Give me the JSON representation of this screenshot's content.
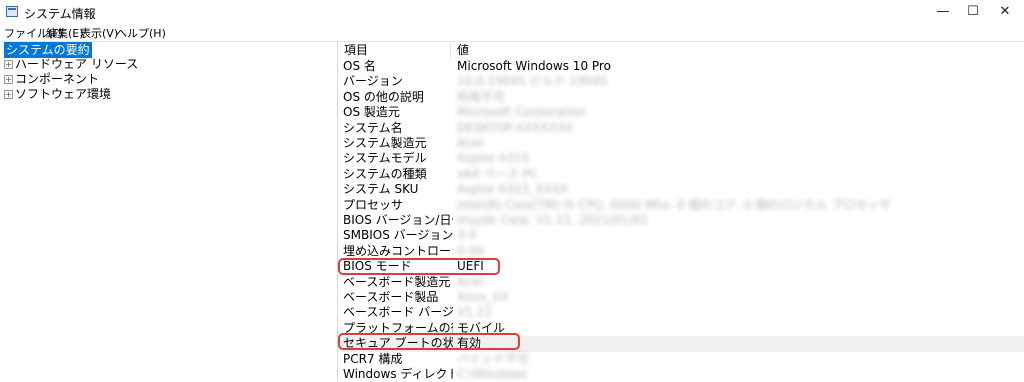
{
  "window": {
    "title": "システム情報",
    "minimize": "—",
    "maximize": "☐",
    "close": "✕"
  },
  "menu": [
    "ファイル(F)",
    "編集(E)",
    "表示(V)",
    "ヘルプ(H)"
  ],
  "tree": {
    "selected": "システムの要約",
    "items": [
      "ハードウェア リソース",
      "コンポーネント",
      "ソフトウェア環境"
    ],
    "expander": "+"
  },
  "table": {
    "headers": [
      "項目",
      "値"
    ],
    "rows": [
      {
        "item": "OS 名",
        "value": "Microsoft Windows 10 Pro",
        "redacted": false
      },
      {
        "item": "バージョン",
        "value": "10.0.19045 ビルド 19045",
        "redacted": true
      },
      {
        "item": "OS の他の説明",
        "value": "利用不可",
        "redacted": true
      },
      {
        "item": "OS 製造元",
        "value": "Microsoft Corporation",
        "redacted": true
      },
      {
        "item": "システム名",
        "value": "DESKTOP-XXXXXXX",
        "redacted": true
      },
      {
        "item": "システム製造元",
        "value": "Acer",
        "redacted": true
      },
      {
        "item": "システムモデル",
        "value": "Aspire A315",
        "redacted": true
      },
      {
        "item": "システムの種類",
        "value": "x64 ベース PC",
        "redacted": true
      },
      {
        "item": "システム SKU",
        "value": "Aspire A315_XXXX",
        "redacted": true
      },
      {
        "item": "プロセッサ",
        "value": "Intel(R) Core(TM) i5 CPU, 0000 Mhz, 0 個のコア, 0 個のロジカル プロセッサ",
        "redacted": true
      },
      {
        "item": "BIOS バージョン/日付",
        "value": "Insyde Corp. V1.11, 2021/01/01",
        "redacted": true
      },
      {
        "item": "SMBIOS バージョン",
        "value": "3.0",
        "redacted": true
      },
      {
        "item": "埋め込みコントローラーのバージョン",
        "value": "0.00",
        "redacted": true
      },
      {
        "item": "BIOS モード",
        "value": "UEFI",
        "redacted": false
      },
      {
        "item": "ベースボード製造元",
        "value": "Acer",
        "redacted": true
      },
      {
        "item": "ベースボード製品",
        "value": "Xxxx_XX",
        "redacted": true
      },
      {
        "item": "ベースボード バージョン",
        "value": "V1.11",
        "redacted": true
      },
      {
        "item": "プラットフォームの役割",
        "value": "モバイル",
        "redacted": false
      },
      {
        "item": "セキュア ブートの状態",
        "value": "有効",
        "redacted": false
      },
      {
        "item": "PCR7 構成",
        "value": "バインド不可",
        "redacted": true
      },
      {
        "item": "Windows ディレクトリ",
        "value": "C:\\Windows",
        "redacted": true
      }
    ]
  },
  "highlight_color": "#e03b3b",
  "selection_color": "#0078d7"
}
